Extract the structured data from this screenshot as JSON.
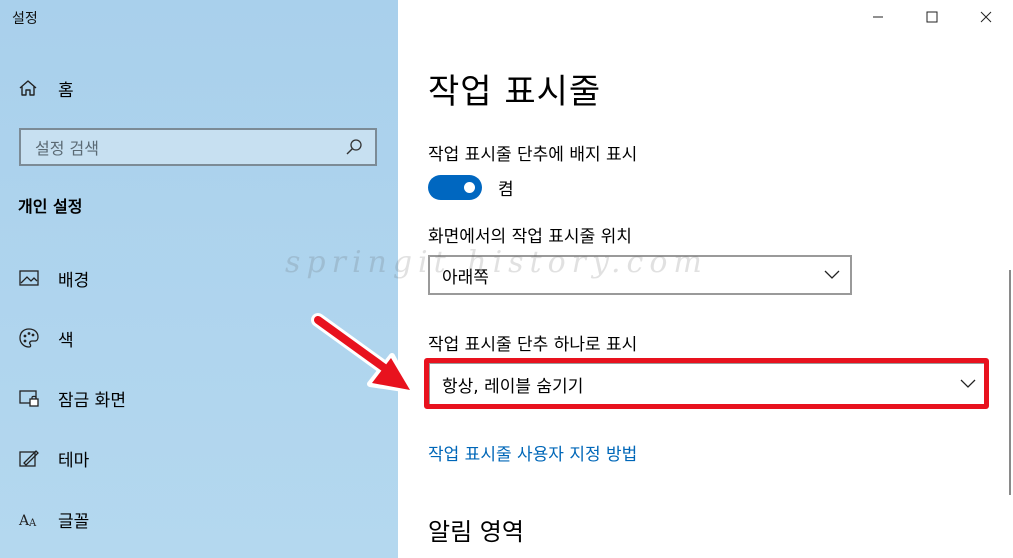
{
  "window": {
    "title": "설정"
  },
  "sidebar": {
    "home_label": "홈",
    "search_placeholder": "설정 검색",
    "section_title": "개인 설정",
    "items": [
      {
        "label": "배경",
        "icon": "picture-icon"
      },
      {
        "label": "색",
        "icon": "palette-icon"
      },
      {
        "label": "잠금 화면",
        "icon": "lock-screen-icon"
      },
      {
        "label": "테마",
        "icon": "theme-icon"
      },
      {
        "label": "글꼴",
        "icon": "font-icon"
      }
    ]
  },
  "main": {
    "page_title": "작업 표시줄",
    "badge_setting": {
      "label": "작업 표시줄 단추에 배지 표시",
      "toggle_state": "켬"
    },
    "position_setting": {
      "label": "화면에서의 작업 표시줄 위치",
      "value": "아래쪽"
    },
    "combine_setting": {
      "label": "작업 표시줄 단추 하나로 표시",
      "value": "항상, 레이블 숨기기"
    },
    "customize_link": "작업 표시줄 사용자 지정 방법",
    "notification_section": "알림 영역"
  },
  "watermark": "springit history.com",
  "colors": {
    "accent": "#0067c0",
    "highlight": "#e8121e",
    "sidebar_bg": "#b0d4ee",
    "link": "#0067b8"
  }
}
